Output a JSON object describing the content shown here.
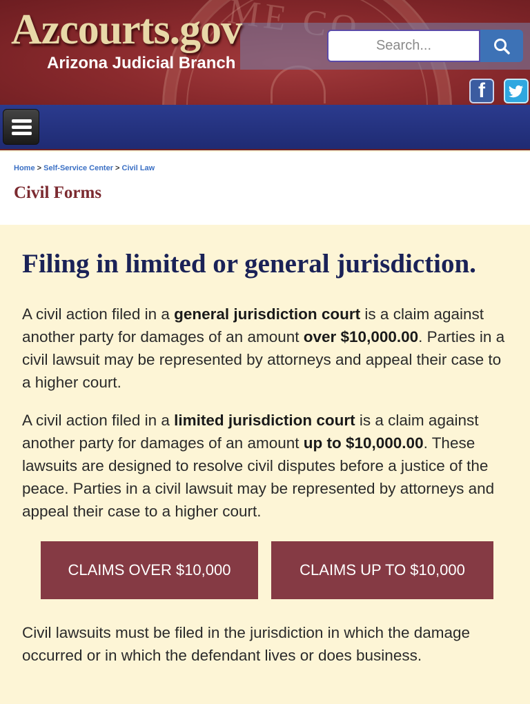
{
  "header": {
    "logo": "Azcourts.gov",
    "tagline": "Arizona Judicial Branch",
    "search_placeholder": "Search...",
    "seal_text": "ME CO"
  },
  "social": {
    "facebook": "f"
  },
  "breadcrumb": {
    "home": "Home",
    "sep1": " > ",
    "self_service": "Self-Service Center",
    "sep2": " > ",
    "civil_law": "Civil Law"
  },
  "page": {
    "title": "Civil Forms"
  },
  "main": {
    "heading": "Filing in limited or general jurisdiction.",
    "p1": {
      "a": "A civil action filed in a ",
      "b": "general jurisdiction court",
      "c": " is a claim against another party for damages of an amount ",
      "d": "over $10,000.00",
      "e": ". Parties in a civil lawsuit may be represented by attorneys and appeal their case to a higher court."
    },
    "p2": {
      "a": "A civil action filed in a ",
      "b": "limited jurisdiction court",
      "c": " is a claim against another party for damages of an amount ",
      "d": "up to $10,000.00",
      "e": ". These lawsuits are designed to resolve civil disputes before a justice of the peace. Parties in a civil lawsuit may be represented by attorneys and appeal their case to a higher court."
    },
    "btn_over": "CLAIMS OVER $10,000",
    "btn_up_to": "CLAIMS UP TO $10,000",
    "p3": "Civil lawsuits must be filed in the jurisdiction in which the damage occurred or in which the defendant lives or does business."
  },
  "colors": {
    "header_red": "#8a2a2d",
    "nav_blue": "#2b3b8e",
    "button_maroon": "#853a44",
    "heading_navy": "#1a2257",
    "title_maroon": "#7b2a30",
    "body_bg": "#fdf5d6",
    "link_blue": "#3a6fc4"
  },
  "icons": [
    "search-icon",
    "facebook-icon",
    "twitter-icon",
    "menu-icon"
  ]
}
